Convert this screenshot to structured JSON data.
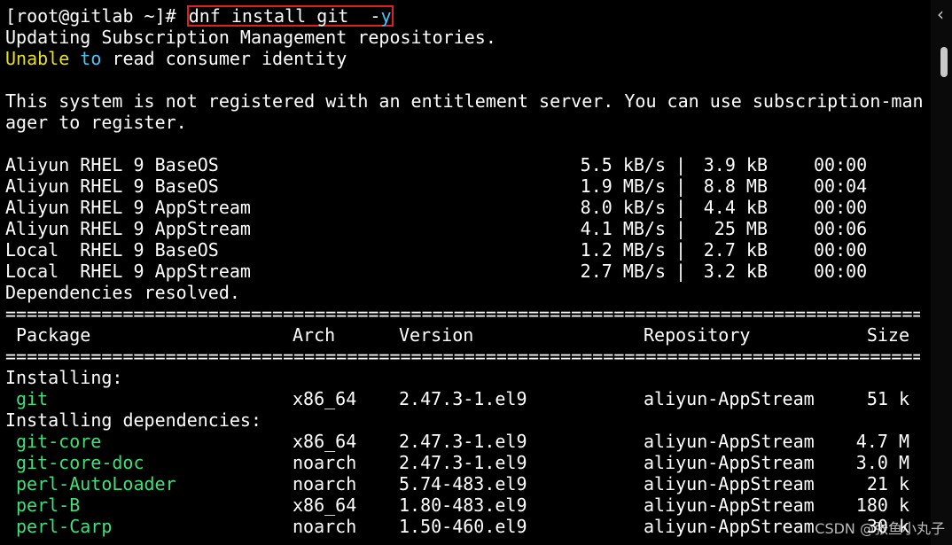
{
  "prompt": {
    "user_host": "[root@gitlab ~]# ",
    "command": "dnf install git  -",
    "flag": "y"
  },
  "messages": {
    "updating": "Updating Subscription Management repositories.",
    "unable_1": "Unable",
    "unable_2": "to",
    "unable_3": "read consumer identity",
    "notice_1": "This system is not registered with an entitlement server. You can use subscription-man",
    "notice_2": "ager to register.",
    "deps_resolved": "Dependencies resolved."
  },
  "repos": [
    {
      "name": "Aliyun RHEL 9 BaseOS",
      "rate": "5.5 kB/s",
      "sep": "|",
      "size": "3.9 kB",
      "time": "00:00"
    },
    {
      "name": "Aliyun RHEL 9 BaseOS",
      "rate": "1.9 MB/s",
      "sep": "|",
      "size": "8.8 MB",
      "time": "00:04"
    },
    {
      "name": "Aliyun RHEL 9 AppStream",
      "rate": "8.0 kB/s",
      "sep": "|",
      "size": "4.4 kB",
      "time": "00:00"
    },
    {
      "name": "Aliyun RHEL 9 AppStream",
      "rate": "4.1 MB/s",
      "sep": "|",
      "size": " 25 MB",
      "time": "00:06"
    },
    {
      "name": "Local  RHEL 9 BaseOS",
      "rate": "1.2 MB/s",
      "sep": "|",
      "size": "2.7 kB",
      "time": "00:00"
    },
    {
      "name": "Local  RHEL 9 AppStream",
      "rate": "2.7 MB/s",
      "sep": "|",
      "size": "3.2 kB",
      "time": "00:00"
    }
  ],
  "table": {
    "rule": "===========================================================================================",
    "headers": {
      "package": "Package",
      "arch": "Arch",
      "version": "Version",
      "repository": "Repository",
      "size": "Size"
    },
    "installing_label": "Installing:",
    "deps_label": "Installing dependencies:",
    "installing": [
      {
        "name": "git",
        "arch": "x86_64",
        "version": "2.47.3-1.el9",
        "repo": "aliyun-AppStream",
        "size": "51 k"
      }
    ],
    "dependencies": [
      {
        "name": "git-core",
        "arch": "x86_64",
        "version": "2.47.3-1.el9",
        "repo": "aliyun-AppStream",
        "size": "4.7 M"
      },
      {
        "name": "git-core-doc",
        "arch": "noarch",
        "version": "2.47.3-1.el9",
        "repo": "aliyun-AppStream",
        "size": "3.0 M"
      },
      {
        "name": "perl-AutoLoader",
        "arch": "noarch",
        "version": "5.74-483.el9",
        "repo": "aliyun-AppStream",
        "size": "21 k"
      },
      {
        "name": "perl-B",
        "arch": "x86_64",
        "version": "1.80-483.el9",
        "repo": "aliyun-AppStream",
        "size": "180 k"
      },
      {
        "name": "perl-Carp",
        "arch": "noarch",
        "version": "1.50-460.el9",
        "repo": "aliyun-AppStream",
        "size": "30 k"
      }
    ]
  },
  "watermark": "CSDN @张鱼小丸子",
  "colors": {
    "background": "#000000",
    "text": "#ffffff",
    "warning": "#e8e020",
    "flag": "#4fc3f7",
    "package": "#3fe07a",
    "highlight_box": "#e0201c"
  },
  "icons": {
    "collapse": "chevron-left-icon"
  }
}
